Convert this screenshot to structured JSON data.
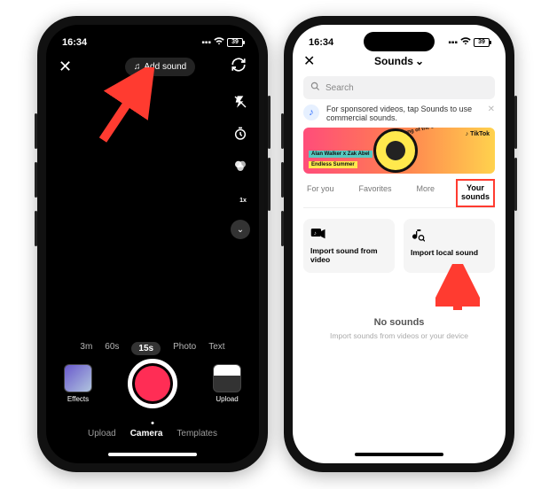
{
  "statusbar": {
    "time": "16:34",
    "battery": "39"
  },
  "camera": {
    "add_sound": "Add sound",
    "durations": [
      "3m",
      "60s",
      "15s",
      "Photo",
      "Text"
    ],
    "duration_active": 2,
    "effects_label": "Effects",
    "upload_label": "Upload",
    "modes": [
      "Upload",
      "Camera",
      "Templates"
    ],
    "mode_active": 1
  },
  "sounds": {
    "title": "Sounds",
    "search_placeholder": "Search",
    "info_text": "For sponsored videos, tap Sounds to use commercial sounds.",
    "promo": {
      "brand": "TikTok",
      "tag_a": "Alan Walker x Zak Abel",
      "tag_b": "Endless Summer",
      "ring": "song of the summer"
    },
    "tabs": [
      "For you",
      "Favorites",
      "More",
      "Your sounds"
    ],
    "tab_active": 3,
    "import_video": "Import sound from video",
    "import_local": "Import local sound",
    "empty_title": "No sounds",
    "empty_sub": "Import sounds from videos or your device"
  }
}
